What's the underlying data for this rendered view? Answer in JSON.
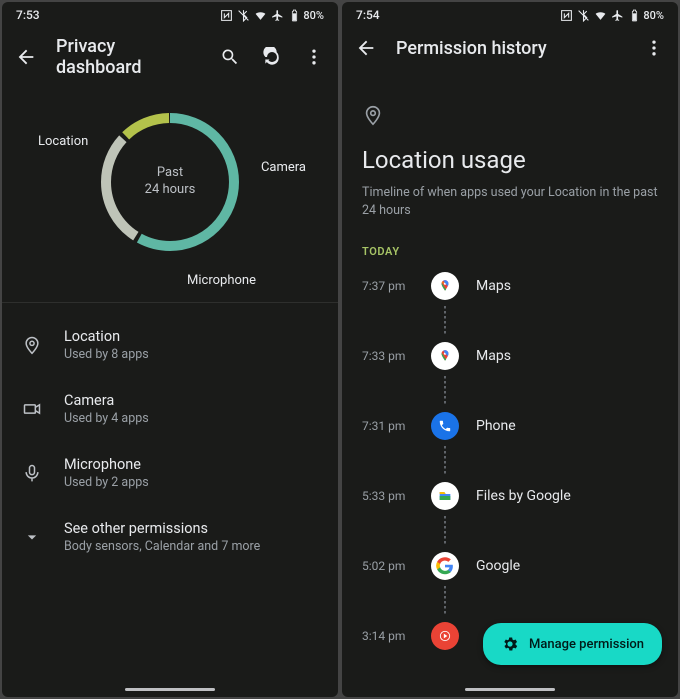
{
  "left": {
    "status": {
      "time": "7:53",
      "battery": "80%"
    },
    "appbar": {
      "title": "Privacy dashboard"
    },
    "donut": {
      "center_line1": "Past",
      "center_line2": "24 hours",
      "labels": {
        "location": "Location",
        "camera": "Camera",
        "microphone": "Microphone"
      },
      "segments": {
        "location_pct": 58,
        "camera_pct": 28,
        "microphone_pct": 14
      },
      "colors": {
        "location": "#5fb7a4",
        "camera": "#bfc4b8",
        "microphone": "#b3c24b"
      }
    },
    "perms": {
      "location": {
        "title": "Location",
        "sub": "Used by 8 apps"
      },
      "camera": {
        "title": "Camera",
        "sub": "Used by 4 apps"
      },
      "mic": {
        "title": "Microphone",
        "sub": "Used by 2 apps"
      },
      "other": {
        "title": "See other permissions",
        "sub": "Body sensors, Calendar and 7 more"
      }
    }
  },
  "right": {
    "status": {
      "time": "7:54",
      "battery": "80%"
    },
    "appbar": {
      "title": "Permission history"
    },
    "header": {
      "title": "Location usage",
      "sub": "Timeline of when apps used your Location in the past 24 hours"
    },
    "section": "TODAY",
    "timeline": [
      {
        "time": "7:37 pm",
        "app": "Maps",
        "icon": "maps"
      },
      {
        "time": "7:33 pm",
        "app": "Maps",
        "icon": "maps"
      },
      {
        "time": "7:31 pm",
        "app": "Phone",
        "icon": "phone"
      },
      {
        "time": "5:33 pm",
        "app": "Files by Google",
        "icon": "files"
      },
      {
        "time": "5:02 pm",
        "app": "Google",
        "icon": "google"
      },
      {
        "time": "3:14 pm",
        "app": "",
        "icon": "youtube"
      }
    ],
    "fab": "Manage permission"
  }
}
